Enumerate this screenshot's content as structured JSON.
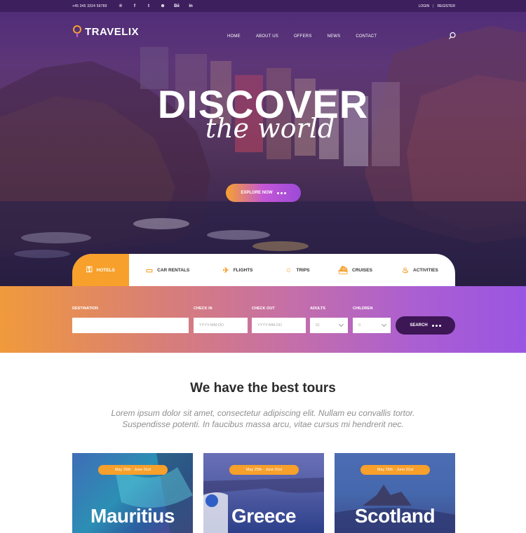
{
  "topbar": {
    "phone": "+45 345 3324 56789",
    "social_icons": [
      "pinterest-icon",
      "facebook-icon",
      "twitter-icon",
      "dribbble-icon",
      "behance-icon",
      "linkedin-icon"
    ],
    "social_glyphs": [
      "℗",
      "f",
      "t",
      "⊛",
      "Bē",
      "in"
    ],
    "login": "login",
    "separator": "|",
    "register": "register"
  },
  "header": {
    "logo": "TRAVELIX",
    "nav": [
      "home",
      "about us",
      "offers",
      "news",
      "contact"
    ]
  },
  "hero": {
    "headline": "DISCOVER",
    "script": "the world",
    "cta": "explore now"
  },
  "tabs": [
    {
      "label": "hotels",
      "icon": "hotel-icon",
      "glyph": "⚿",
      "active": true
    },
    {
      "label": "car rentals",
      "icon": "car-icon",
      "glyph": "▭",
      "active": false
    },
    {
      "label": "flights",
      "icon": "plane-icon",
      "glyph": "✈",
      "active": false
    },
    {
      "label": "trips",
      "icon": "trips-icon",
      "glyph": "☼",
      "active": false
    },
    {
      "label": "cruises",
      "icon": "ship-icon",
      "glyph": "⛴",
      "active": false
    },
    {
      "label": "activities",
      "icon": "snorkel-icon",
      "glyph": "♨",
      "active": false
    }
  ],
  "search_form": {
    "destination_label": "destination",
    "checkin_label": "check in",
    "checkin_placeholder": "YYYY-MM-DD",
    "checkout_label": "check out",
    "checkout_placeholder": "YYYY-MM-DD",
    "adults_label": "adults",
    "adults_value": "01",
    "children_label": "children",
    "children_value": "0",
    "search_button": "search"
  },
  "tours": {
    "title": "We have the best tours",
    "text_line1": "Lorem ipsum dolor sit amet, consectetur adipiscing elit. Nullam eu convallis tortor.",
    "text_line2": "Suspendisse potenti. In faucibus massa arcu, vitae cursus mi hendrerit nec.",
    "cards": [
      {
        "date": "May 25th - June 01st",
        "name": "Mauritius"
      },
      {
        "date": "May 25th - June 01st",
        "name": "Greece"
      },
      {
        "date": "May 25th - June 01st",
        "name": "Scotland"
      }
    ]
  },
  "colors": {
    "topbar": "#3d1f5e",
    "accent_orange": "#f7a02b",
    "accent_purple": "#9a55e2",
    "search_button": "#3d1656"
  }
}
